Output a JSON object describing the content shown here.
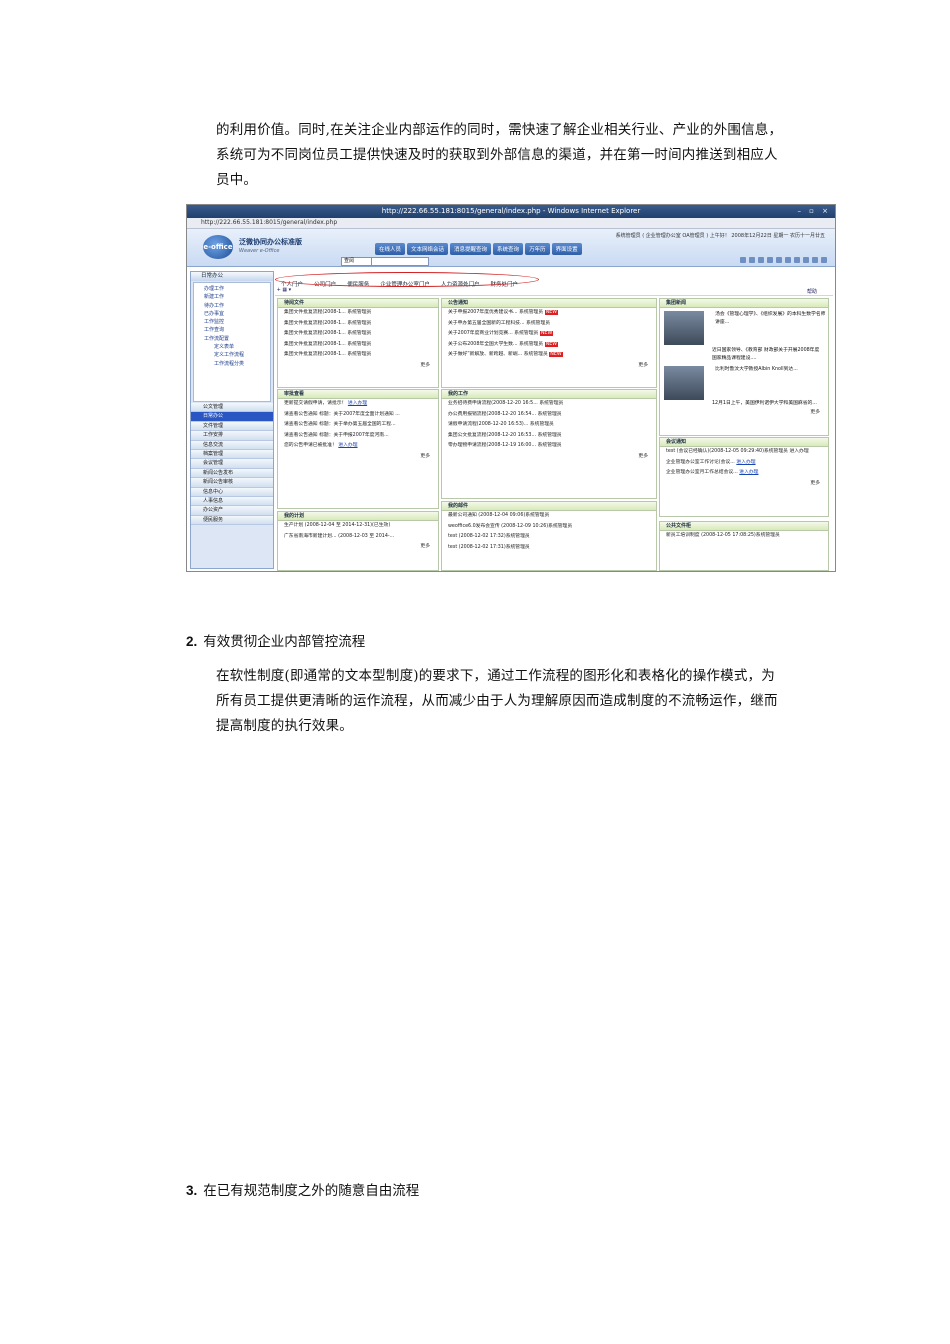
{
  "intro": {
    "lines": [
      "的利用价值。同时,在关注企业内部运作的同时，需快速了解企业相关行业、产业的外围信息，",
      "系统可为不同岗位员工提供快速及时的获取到外部信息的渠道，并在第一时间内推送到相应人",
      "员中。"
    ]
  },
  "screenshot": {
    "window_title": "http://222.66.55.181:8015/general/index.php - Windows Internet Explorer",
    "address": "http://222.66.55.181:8015/general/index.php",
    "brand": "泛微协同办公标准版",
    "brand_sub": "Weaver e-Office",
    "logo": "e-office",
    "user_info": "系统管理员 ( 企业管理办公室 OA管理员 ) 上午好！ 2008年12月22日 星期一 农历十一月廿五",
    "top_nav": [
      "在线人员",
      "文本网络会话",
      "消息提醒查询",
      "系统查询",
      "万年历",
      "界面设置"
    ],
    "search_value": "查阅",
    "portal_tabs": [
      "个人门户",
      "公司门户",
      "便民服务",
      "企业管理办公室门户",
      "人力资源处门户",
      "财务处门户"
    ],
    "help": "帮助",
    "sidebar_head": "日常办公",
    "tree": [
      {
        "label": "办理工作",
        "level": 1
      },
      {
        "label": "新建工作",
        "level": 1
      },
      {
        "label": "待办工作",
        "level": 1
      },
      {
        "label": "已办事宜",
        "level": 1
      },
      {
        "label": "工作监控",
        "level": 1
      },
      {
        "label": "工作查询",
        "level": 1
      },
      {
        "label": "工作流配置",
        "level": 1
      },
      {
        "label": "定义表单",
        "level": 2
      },
      {
        "label": "定义工作流程",
        "level": 2
      },
      {
        "label": "工作流程分类",
        "level": 2
      }
    ],
    "menu": [
      "公文管理",
      "日常办公",
      "文件管理",
      "工作安排",
      "信息交流",
      "档案管理",
      "会议管理",
      "新闻公告发布",
      "新闻公告审核",
      "信息中心",
      "人事信息",
      "办公资产",
      "便民服务"
    ],
    "menu_selected": 1,
    "panels": {
      "docs": {
        "title": "待阅文件",
        "rows": [
          "集团文件批复流程(2008-1... 系统管理员",
          "集团文件批复流程(2008-1... 系统管理员",
          "集团文件批复流程(2008-1... 系统管理员",
          "集团文件批复流程(2008-1... 系统管理员",
          "集团文件批复流程(2008-1... 系统管理员"
        ],
        "more": "更多"
      },
      "notice": {
        "title": "公告通知",
        "rows": [
          "关于申报2007年度优秀建议书...",
          "关于申办第五届全国新的工程科技...",
          "关于2007年度商业计划竞赛...",
          "关于公布2008年全国大学生数...",
          "关于做好“新解放、新跨越、新崛..."
        ],
        "owner": "系统管理员",
        "new_tag": "NEW",
        "more": "更多"
      },
      "news": {
        "title": "集团新闻",
        "items": [
          "汤会《管理心理学》、《组织发展》的本科生数学名师讲座...",
          "近日国家领导、《教育部 财政部关于开展2008年度国家精品课程建设....",
          "比利时鲁汶大学教授Albin Knoll到达...",
          "12月1日上午，美国伊利诺伊大学和美国麻省的..."
        ],
        "owner": "系统管理员",
        "more": "更多"
      },
      "todo": {
        "title": "我的工作",
        "rows": [
          "业务招待费申请流程(2008-12-20 16:5...",
          "办公费用报销流程(2008-12-20 16:54...",
          "请假申请流程(2008-12-20 16:53)...",
          "集团公文批复流程(2008-12-20 16:53...",
          "零办理物申请流程(2008-12-19 16:00..."
        ],
        "owner": "系统管理员",
        "more": "更多"
      },
      "approve": {
        "title": "审批查看",
        "rows": [
          "更新提交请假申请，请批示！",
          "请查看公告通知 标题：关于2007年度全面计划通知 ...",
          "请查看公告通知 标题：关于举办第五届全国的工程...",
          "请查看公告通知 标题：关于申报2007年度河南...",
          "您的公告申请已被批准！"
        ],
        "link": "进入办理",
        "more": "更多"
      },
      "plan": {
        "title": "我的计划",
        "rows": [
          "生产计划 (2008-12-04 至 2014-12-31)(已生效)",
          "广东省南海市新建计划... (2008-12-03 至 2014-..."
        ],
        "more": "更多"
      },
      "meeting": {
        "title": "会议通知",
        "rows": [
          "test (会议已经确认)(2008-12-05 09:29:40)系统管理员 进入办理",
          "企业管理办公室工作讨论(会议...",
          "企业管理办公室月工作总结会议..."
        ],
        "link": "进入办理",
        "more": "更多"
      },
      "mail": {
        "title": "我的邮件",
        "rows": [
          "最新公司通知 (2008-12-04 09:06)系统管理员",
          "weoffice6.0发布会宣传 (2008-12-09 10:26)系统管理员",
          "test (2008-12-02 17:32)系统管理员",
          "test (2008-12-02 17:31)系统管理员"
        ]
      },
      "files": {
        "title": "公共文件柜",
        "rows": [
          "新员工培训制度 (2008-12-05 17:08:25)系统管理员"
        ]
      }
    }
  },
  "section2": {
    "number": "2.",
    "heading": "有效贯彻企业内部管控流程",
    "lines": [
      "在软性制度(即通常的文本型制度)的要求下，通过工作流程的图形化和表格化的操作模式，为",
      "所有员工提供更清晰的运作流程，从而减少由于人为理解原因而造成制度的不流畅运作，继而",
      "提高制度的执行效果。"
    ]
  },
  "section3": {
    "number": "3.",
    "heading": "在已有规范制度之外的随意自由流程"
  }
}
